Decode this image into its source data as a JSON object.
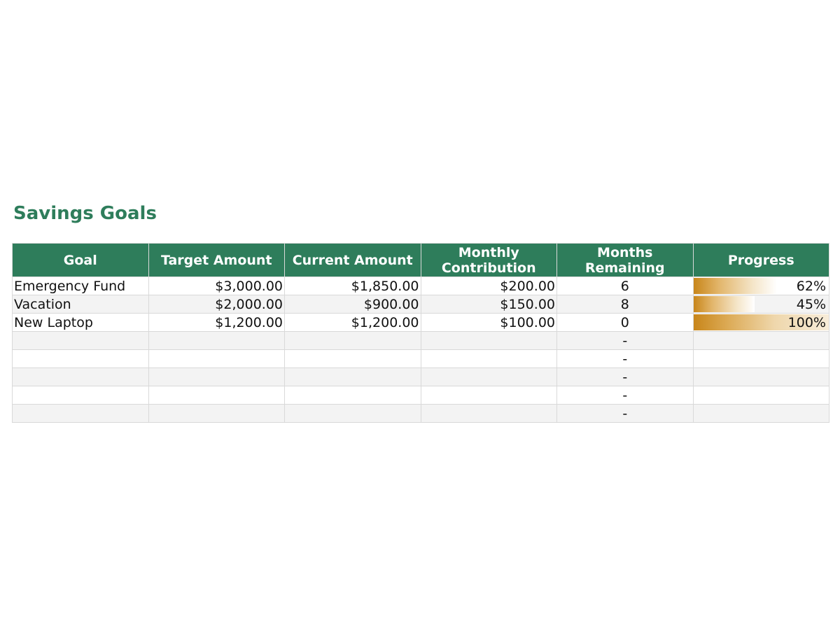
{
  "title": "Savings Goals",
  "colors": {
    "header_bg": "#2e7d5b",
    "title": "#2e7d5b",
    "bar": "#c8861a",
    "row_alt": "#f3f3f3"
  },
  "columns": [
    "Goal",
    "Target Amount",
    "Current Amount",
    "Monthly Contribution",
    "Months Remaining",
    "Progress"
  ],
  "rows": [
    {
      "goal": "Emergency Fund",
      "target": "$3,000.00",
      "current": "$1,850.00",
      "monthly": "$200.00",
      "months": "6",
      "progress_label": "62%",
      "progress": 0.62
    },
    {
      "goal": "Vacation",
      "target": "$2,000.00",
      "current": "$900.00",
      "monthly": "$150.00",
      "months": "8",
      "progress_label": "45%",
      "progress": 0.45
    },
    {
      "goal": "New Laptop",
      "target": "$1,200.00",
      "current": "$1,200.00",
      "monthly": "$100.00",
      "months": "0",
      "progress_label": "100%",
      "progress": 1.0
    },
    {
      "goal": "",
      "target": "",
      "current": "",
      "monthly": "",
      "months": "-",
      "progress_label": "",
      "progress": 0
    },
    {
      "goal": "",
      "target": "",
      "current": "",
      "monthly": "",
      "months": "-",
      "progress_label": "",
      "progress": 0
    },
    {
      "goal": "",
      "target": "",
      "current": "",
      "monthly": "",
      "months": "-",
      "progress_label": "",
      "progress": 0
    },
    {
      "goal": "",
      "target": "",
      "current": "",
      "monthly": "",
      "months": "-",
      "progress_label": "",
      "progress": 0
    },
    {
      "goal": "",
      "target": "",
      "current": "",
      "monthly": "",
      "months": "-",
      "progress_label": "",
      "progress": 0
    }
  ]
}
